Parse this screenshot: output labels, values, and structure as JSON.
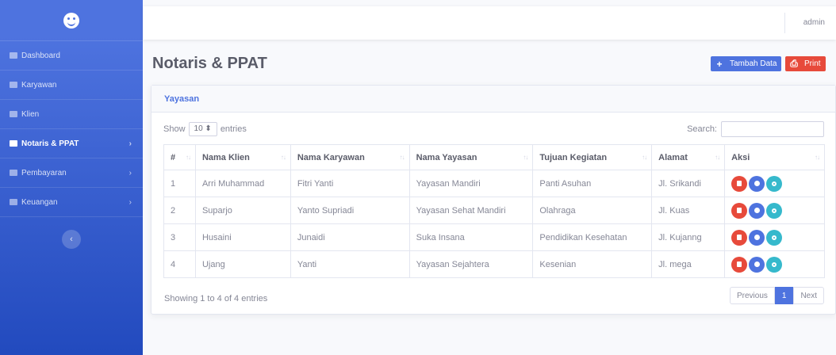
{
  "sidebar": {
    "items": [
      {
        "label": "Dashboard",
        "icon": "tachometer-icon",
        "chevron": ""
      },
      {
        "label": "Karyawan",
        "icon": "user-icon",
        "chevron": ""
      },
      {
        "label": "Klien",
        "icon": "user-plus-icon",
        "chevron": ""
      },
      {
        "label": "Notaris & PPAT",
        "icon": "book-icon",
        "chevron": "›"
      },
      {
        "label": "Pembayaran",
        "icon": "credit-card-icon",
        "chevron": "›"
      },
      {
        "label": "Keuangan",
        "icon": "money-icon",
        "chevron": "›"
      }
    ],
    "toggle": "‹"
  },
  "topbar": {
    "user": "admin"
  },
  "page": {
    "title": "Notaris & PPAT",
    "add_label": "Tambah Data",
    "print_label": "Print"
  },
  "card": {
    "header": "Yayasan",
    "show_label": "Show",
    "entries_value": "10 ⬍",
    "entries_label": "entries",
    "search_label": "Search:",
    "columns": [
      "#",
      "Nama Klien",
      "Nama Karyawan",
      "Nama Yayasan",
      "Tujuan Kegiatan",
      "Alamat",
      "Aksi"
    ],
    "rows": [
      [
        "1",
        "Arri Muhammad",
        "Fitri Yanti",
        "Yayasan Mandiri",
        "Panti Asuhan",
        "Jl. Srikandi"
      ],
      [
        "2",
        "Suparjo",
        "Yanto Supriadi",
        "Yayasan Sehat Mandiri",
        "Olahraga",
        "Jl. Kuas"
      ],
      [
        "3",
        "Husaini",
        "Junaidi",
        "Suka Insana",
        "Pendidikan Kesehatan",
        "Jl. Kujanng"
      ],
      [
        "4",
        "Ujang",
        "Yanti",
        "Yayasan Sejahtera",
        "Kesenian",
        "Jl. mega"
      ]
    ],
    "info": "Showing 1 to 4 of 4 entries",
    "pager": {
      "prev": "Previous",
      "current": "1",
      "next": "Next"
    }
  },
  "colors": {
    "primary": "#4e73df",
    "danger": "#e74a3b",
    "info": "#36b9cc"
  }
}
